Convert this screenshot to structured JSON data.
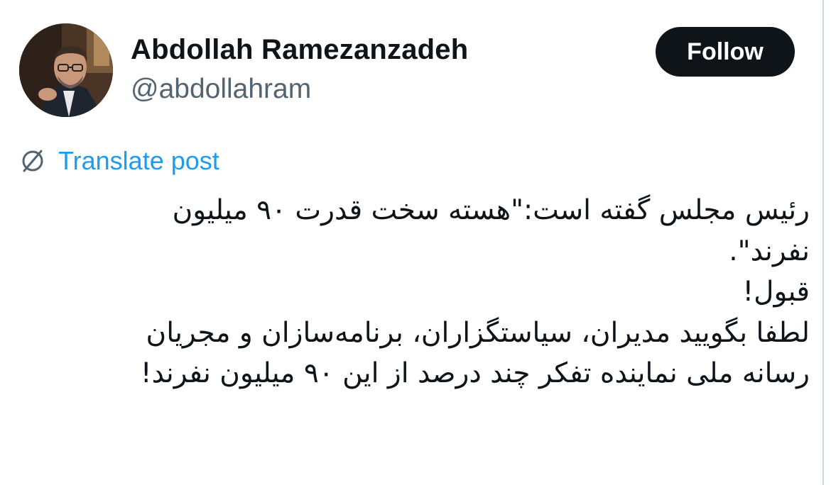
{
  "author": {
    "display_name": "Abdollah Ramezanzadeh",
    "handle": "@abdollahram"
  },
  "actions": {
    "follow_label": "Follow",
    "translate_label": "Translate post",
    "translate_icon": "translate-icon"
  },
  "post": {
    "lines": [
      "رئیس مجلس گفته است:\"هسته سخت قدرت ۹۰ میلیون",
      "نفرند\".",
      "قبول!",
      "لطفا بگویید مدیران، سیاستگزاران، برنامه‌سازان و مجریان",
      "رسانه ملی نماینده تفکر چند درصد از این ۹۰ میلیون نفرند!"
    ]
  },
  "colors": {
    "text_primary": "#0f1419",
    "text_secondary": "#536471",
    "link_blue": "#1d9bf0",
    "button_bg": "#0f1419",
    "button_text": "#ffffff"
  }
}
